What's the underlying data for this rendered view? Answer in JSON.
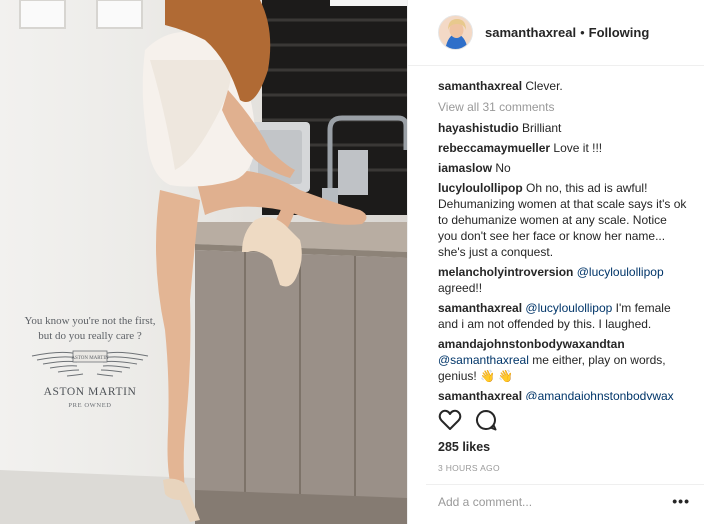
{
  "ad": {
    "tagline_line1": "You know you're not the first,",
    "tagline_line2": "but do you really care ?",
    "logo_text": "ASTON MARTIN",
    "brand": "ASTON MARTIN",
    "subbrand": "PRE OWNED"
  },
  "header": {
    "username": "samanthaxreal",
    "separator": "•",
    "follow_status": "Following"
  },
  "caption": {
    "username": "samanthaxreal",
    "text": "Clever."
  },
  "view_all": "View all 31 comments",
  "comments": [
    {
      "username": "hayashistudio",
      "mention": "",
      "text": "Brilliant"
    },
    {
      "username": "rebeccamaymueller",
      "mention": "",
      "text": "Love it !!!"
    },
    {
      "username": "iamaslow",
      "mention": "",
      "text": "No"
    },
    {
      "username": "lucyloulollipop",
      "mention": "",
      "text": "Oh no, this ad is awful! Dehumanizing women at that scale says it's ok to dehumanize women at any scale. Notice you don't see her face or know her name... she's just a conquest."
    },
    {
      "username": "melancholyintroversion",
      "mention": "@lucyloulollipop",
      "text": "agreed!!"
    },
    {
      "username": "samanthaxreal",
      "mention": "@lucyloulollipop",
      "text": "I'm female and i am not offended by this. I laughed."
    },
    {
      "username": "amandajohnstonbodywaxandtan",
      "mention": "@samanthaxreal",
      "text": "me either, play on words, genius! 👋 👋"
    },
    {
      "username": "samanthaxreal",
      "mention": "@amandajohnstonbodywax",
      "text": ""
    }
  ],
  "actions": {
    "like_icon": "heart-outline",
    "comment_icon": "speech-bubble"
  },
  "likes": "285 likes",
  "time_ago": "3 HOURS AGO",
  "add_comment": {
    "placeholder": "Add a comment...",
    "value": ""
  },
  "more_label": "•••",
  "colors": {
    "text": "#262626",
    "muted": "#999999",
    "mention": "#003569",
    "divider": "#efefef"
  }
}
